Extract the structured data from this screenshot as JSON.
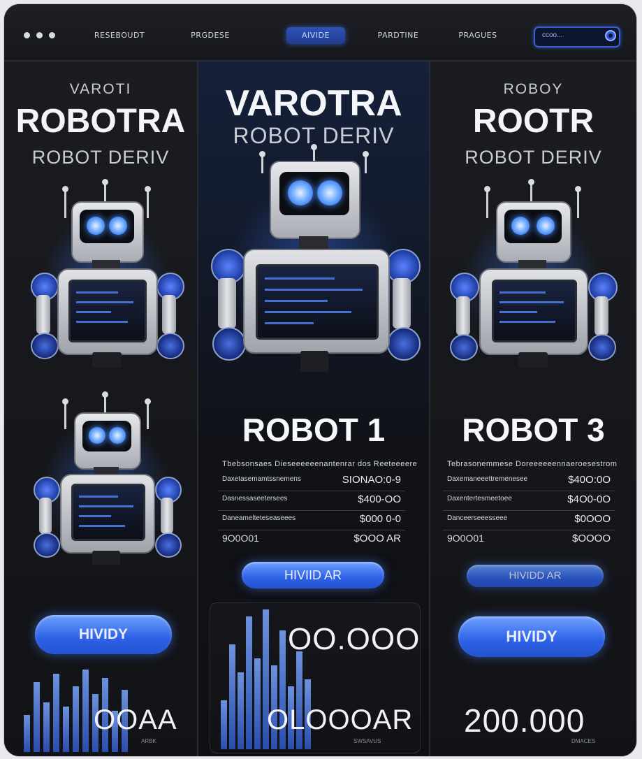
{
  "nav": {
    "items": [
      "RESEBOUDT",
      "PRGDESE",
      "AIVIDE",
      "PARDTINE",
      "PRAGUES"
    ],
    "active_index": 2,
    "search_text": "ccoo..."
  },
  "columns": [
    {
      "small_title": "VAROTI",
      "big_title": "ROBOTRA",
      "subtitle": "ROBOT DERIV",
      "button_label": "HIVIDY",
      "total": "OOAA",
      "caption": "ARBK"
    },
    {
      "small_title": "",
      "big_title": "VAROTRA",
      "subtitle": "ROBOT DERIV",
      "robot_name": "ROBOT 1",
      "spec_header": "Tbebsonsaes Dieseeeeeenantenrar dos Reeteeeere",
      "specs": [
        {
          "k": "Daxetasemamtssnemens",
          "v": "SIONAO:0-9"
        },
        {
          "k": "Dasnessaseetersees",
          "v": "$400-OO"
        },
        {
          "k": "Daneamelteteseaseees",
          "v": "$000 0-0"
        },
        {
          "k": "9O0O01",
          "v": "$OOO AR"
        }
      ],
      "button_label": "HIVIID AR",
      "total_top": "OO.OOO",
      "total": "OLOOOAR",
      "caption": "SWSAVUS"
    },
    {
      "small_title": "ROBOY",
      "big_title": "ROOTR",
      "subtitle": "ROBOT DERIV",
      "robot_name": "ROBOT 3",
      "spec_header": "Tebrasonemmese Doreeeeeennaeroesestrom",
      "specs": [
        {
          "k": "Daxemaneeettremenesee",
          "v": "$40O:0O"
        },
        {
          "k": "Daxentertesmeetoee",
          "v": "$4O0-0O"
        },
        {
          "k": "Danceerseeesseee",
          "v": "$0OOO"
        },
        {
          "k": "9O0O01",
          "v": "$OOOO"
        }
      ],
      "button_top_label": "HIVIDD AR",
      "button_label": "HIVIDY",
      "total": "200.000",
      "caption": "DMACES"
    }
  ],
  "colors": {
    "accent": "#3a6cf0",
    "background": "#0e0f13",
    "eye_glow": "#6aa8ff"
  },
  "bar_levels": {
    "left": [
      0.45,
      0.85,
      0.6,
      0.95,
      0.55,
      0.8,
      1.0,
      0.7,
      0.9,
      0.5,
      0.75
    ],
    "mid": [
      0.35,
      0.75,
      0.55,
      0.95,
      0.65,
      1.0,
      0.6,
      0.85,
      0.45,
      0.7,
      0.5
    ],
    "right": []
  }
}
